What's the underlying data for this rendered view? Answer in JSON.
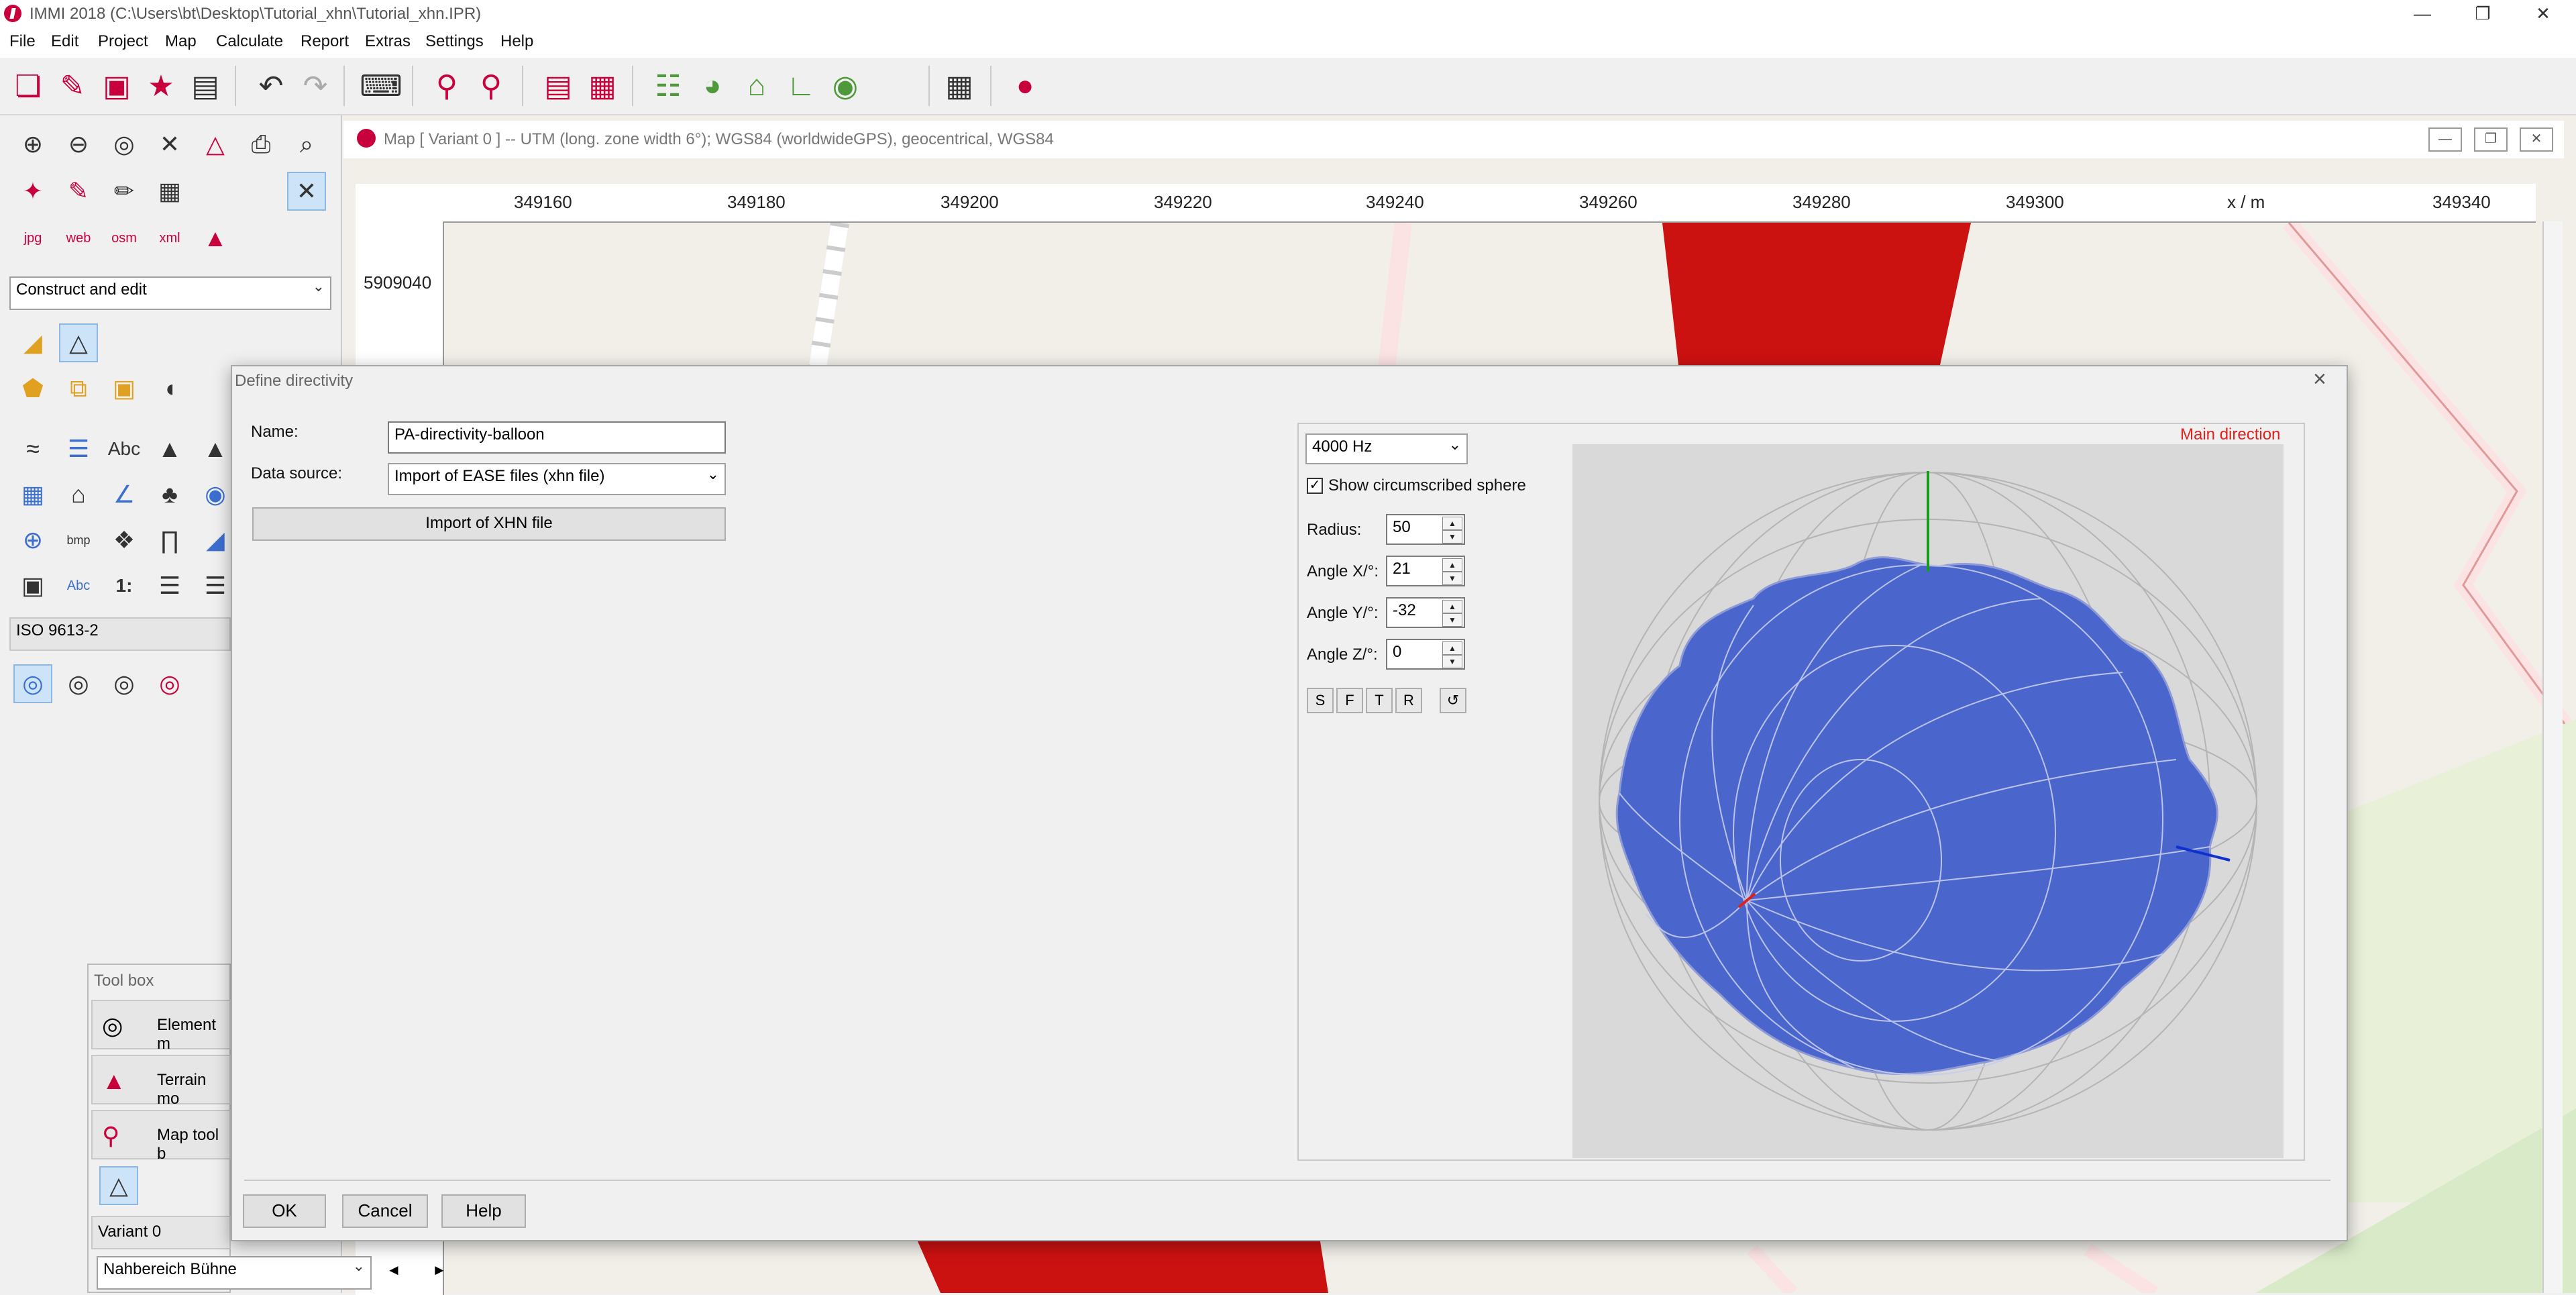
{
  "window": {
    "title": "IMMI 2018 (C:\\Users\\bt\\Desktop\\Tutorial_xhn\\Tutorial_xhn.IPR)",
    "controls": [
      "—",
      "❐",
      "✕"
    ]
  },
  "menu": [
    "File",
    "Edit",
    "Project",
    "Map",
    "Calculate",
    "Report",
    "Extras",
    "Settings",
    "Help"
  ],
  "toolbar": {
    "icons": [
      "new-project-icon",
      "open-icon",
      "save-icon",
      "favorites-icon",
      "properties-icon",
      "undo-icon",
      "redo-icon",
      "keyboard-icon",
      "map-pin-icon",
      "map-pin-edit-icon",
      "book-icon",
      "grid-table-icon",
      "settings-sliders-icon",
      "pie-icon",
      "house-icon",
      "graph-icon",
      "target-icon",
      "calculator-icon",
      "immi-logo-icon"
    ]
  },
  "left_panel": {
    "mode_combo": "Construct and edit",
    "norm_combo": "ISO 9613-2",
    "text_icons": {
      "abc1": "Abc",
      "abc2": "Abc",
      "bmp": "bmp",
      "one": "1:",
      "jpg": "jpg",
      "web": "web",
      "osm": "osm",
      "xml": "xml"
    }
  },
  "map": {
    "title": "Map  [ Variant 0 ]  --  UTM (long. zone width 6°); WGS84 (worldwideGPS), geocentrical, WGS84",
    "x_ticks": [
      "349160",
      "349180",
      "349200",
      "349220",
      "349240",
      "349260",
      "349280",
      "349300",
      "x / m",
      "349340"
    ],
    "y_ticks": [
      "5909040"
    ]
  },
  "dialog": {
    "title": "Define directivity",
    "name_label": "Name:",
    "name_value": "PA-directivity-balloon",
    "source_label": "Data source:",
    "source_value": "Import of EASE files (xhn file)",
    "import_button": "Import of XHN file",
    "frequency": "4000 Hz",
    "sphere_checkbox": "Show circumscribed sphere",
    "sphere_checked": true,
    "radius_label": "Radius:",
    "radius_value": "50",
    "angle_x_label": "Angle X/°:",
    "angle_x_value": "21",
    "angle_y_label": "Angle Y/°:",
    "angle_y_value": "-32",
    "angle_z_label": "Angle Z/°:",
    "angle_z_value": "0",
    "view_buttons": [
      "S",
      "F",
      "T",
      "R",
      "↺"
    ],
    "main_direction": "Main direction",
    "ok": "OK",
    "cancel": "Cancel",
    "help": "Help"
  },
  "toolbox": {
    "title": "Tool box",
    "items": [
      "Element m",
      "Terrain mo",
      "Map tool b"
    ],
    "variant_label": "Variant 0",
    "area_combo": "Nahbereich Bühne",
    "prev": "◄",
    "next": "►"
  },
  "colors": {
    "accent": "#c8003c",
    "balloon": "#4a66cc",
    "building": "#cc1111",
    "main_direction": "#e0201c"
  }
}
